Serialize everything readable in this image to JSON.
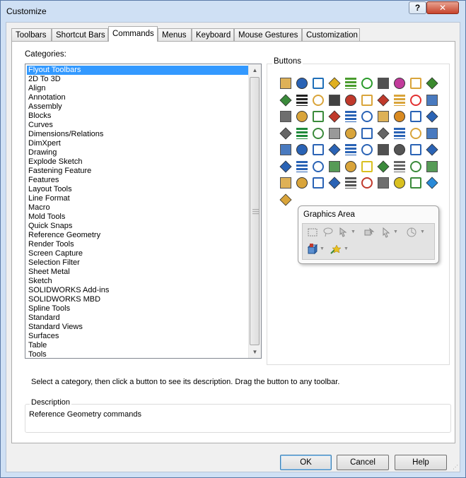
{
  "window": {
    "title": "Customize",
    "help_glyph": "?",
    "close_glyph": "✕"
  },
  "tabs": [
    {
      "label": "Toolbars"
    },
    {
      "label": "Shortcut Bars"
    },
    {
      "label": "Commands"
    },
    {
      "label": "Menus"
    },
    {
      "label": "Keyboard"
    },
    {
      "label": "Mouse Gestures"
    },
    {
      "label": "Customization"
    }
  ],
  "active_tab": "Commands",
  "categories": {
    "label": "Categories:",
    "selected": "Flyout Toolbars",
    "items": [
      "Flyout Toolbars",
      "2D To 3D",
      "Align",
      "Annotation",
      "Assembly",
      "Blocks",
      "Curves",
      "Dimensions/Relations",
      "DimXpert",
      "Drawing",
      "Explode Sketch",
      "Fastening Feature",
      "Features",
      "Layout Tools",
      "Line Format",
      "Macro",
      "Mold Tools",
      "Quick Snaps",
      "Reference Geometry",
      "Render Tools",
      "Screen Capture",
      "Selection Filter",
      "Sheet Metal",
      "Sketch",
      "SOLIDWORKS Add-ins",
      "SOLIDWORKS MBD",
      "Spline Tools",
      "Standard",
      "Standard Views",
      "Surfaces",
      "Table",
      "Tools"
    ],
    "scroll_up": "▲",
    "scroll_down": "▼"
  },
  "buttons_panel": {
    "label": "Buttons",
    "icon_rows": [
      [
        "#d9a43a",
        "#2a63b5",
        "#1f6fb8",
        "#e0b020",
        "#4a9c2e",
        "#2a9a2a",
        "#333333",
        "#c23b9b",
        "#d9a43a",
        "#3b8a2e"
      ],
      [
        "#3a8a3a",
        "#222222",
        "#d9a43a",
        "#222222",
        "#c0392b",
        "#d9a43a",
        "#c0392b",
        "#d9a43a",
        "#e23030",
        "#2a63b5"
      ],
      [
        "#555555",
        "#d9a43a",
        "#3a8a3a",
        "#c0392b",
        "#2a63b5",
        "#2a63b5",
        "#d9a43a",
        "#d98a20",
        "#2a63b5",
        "#2a63b5"
      ],
      [
        "#666666",
        "#1f8a3a",
        "#3a8a3a",
        "#888888",
        "#d9a43a",
        "#2a63b5",
        "#666666",
        "#2a63b5",
        "#d9a43a",
        "#2a63b5"
      ],
      [
        "#2a63b5",
        "#2a63b5",
        "#2a63b5",
        "#2a63b5",
        "#2a63b5",
        "#2a63b5",
        "#333333",
        "#555555",
        "#2a63b5",
        "#2a63b5"
      ],
      [
        "#2a63b5",
        "#2a63b5",
        "#2a63b5",
        "#3a8a3a",
        "#d9a43a",
        "#d9c020",
        "#3a8a3a",
        "#666666",
        "#3a8a3a",
        "#3a8a3a"
      ],
      [
        "#d9a43a",
        "#d9a43a",
        "#2a63b5",
        "#2a63b5",
        "#555555",
        "#c0392b",
        "#555555",
        "#d9c020",
        "#3a8a3a",
        "#2a8ad8"
      ],
      [
        "#d9a43a"
      ]
    ]
  },
  "graphics_area": {
    "title": "Graphics Area"
  },
  "hint": "Select a category, then click a button to see its description. Drag the button to any toolbar.",
  "description": {
    "label": "Description",
    "text": "Reference Geometry commands"
  },
  "footer": {
    "ok": "OK",
    "cancel": "Cancel",
    "help": "Help"
  }
}
